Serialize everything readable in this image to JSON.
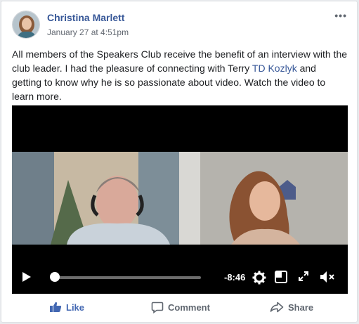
{
  "post": {
    "author": "Christina Marlett",
    "timestamp": "January 27 at 4:51pm",
    "text_before_link": "All members of the Speakers Club receive the benefit of an interview with the club leader. I had the pleasure of connecting with Terry ",
    "link_text": "TD Kozlyk",
    "text_after_link": " and getting to know why he is so passionate about video. Watch the video to learn more.",
    "more_label": "•••"
  },
  "video": {
    "time_remaining": "-8:46",
    "progress": 0.02
  },
  "actions": {
    "like_label": "Like",
    "comment_label": "Comment",
    "share_label": "Share"
  },
  "colors": {
    "link": "#385898",
    "like": "#4267b2",
    "meta": "#616770"
  }
}
